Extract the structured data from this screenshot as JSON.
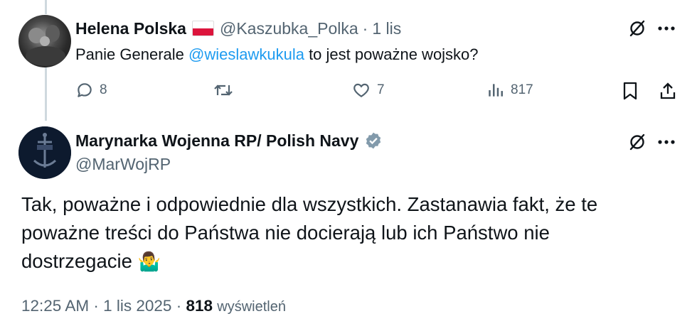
{
  "reply": {
    "author_name": "Helena Polska",
    "author_handle": "@Kaszubka_Polka",
    "separator": "·",
    "time": "1 lis",
    "text_prefix": "Panie Generale ",
    "mention": "@wieslawkukula",
    "text_suffix": " to jest poważne wojsko?",
    "stats": {
      "replies": "8",
      "reposts": "",
      "likes": "7",
      "views": "817"
    }
  },
  "main_post": {
    "author_name": "Marynarka Wojenna RP/ Polish Navy",
    "author_handle": "@MarWojRP",
    "text": "Tak, poważne i odpowiednie dla wszystkich. Zastanawia fakt, że te poważne treści do Państwa nie docierają lub ich Państwo nie dostrzegacie",
    "emoji": "🤷‍♂️",
    "time": "12:25 AM",
    "separator1": "·",
    "date": "1 lis 2025",
    "separator2": "·",
    "views_count": "818",
    "views_label": "wyświetleń"
  },
  "colors": {
    "text": "#0f1419",
    "secondary": "#536471",
    "link": "#1d9bf0",
    "verified": "#829aab",
    "thread_line": "#cfd9de"
  },
  "icons": [
    "grok-icon",
    "more-icon",
    "reply-icon",
    "repost-icon",
    "like-icon",
    "views-icon",
    "bookmark-icon",
    "share-icon",
    "verified-icon",
    "flag-pl-icon"
  ]
}
